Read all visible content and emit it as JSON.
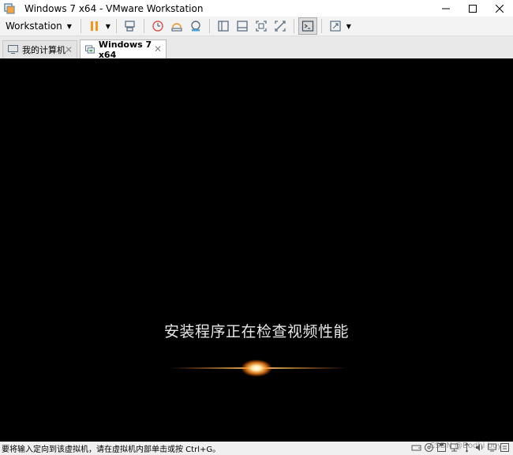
{
  "window": {
    "title": "Windows 7 x64 - VMware Workstation"
  },
  "toolbar": {
    "menu_label": "Workstation"
  },
  "tabs": [
    {
      "label": "我的计算机",
      "active": false
    },
    {
      "label": "Windows 7 x64",
      "active": true
    }
  ],
  "vm": {
    "message": "安装程序正在检查视频性能"
  },
  "statusbar": {
    "hint": "要将输入定向到该虚拟机，请在虚拟机内部单击或按 Ctrl+G。",
    "watermark": "CSDN @Bodhi boy"
  },
  "colors": {
    "accent": "#f7941d",
    "vm_background": "#000000",
    "toolbar_icon": "#5a6e82"
  }
}
